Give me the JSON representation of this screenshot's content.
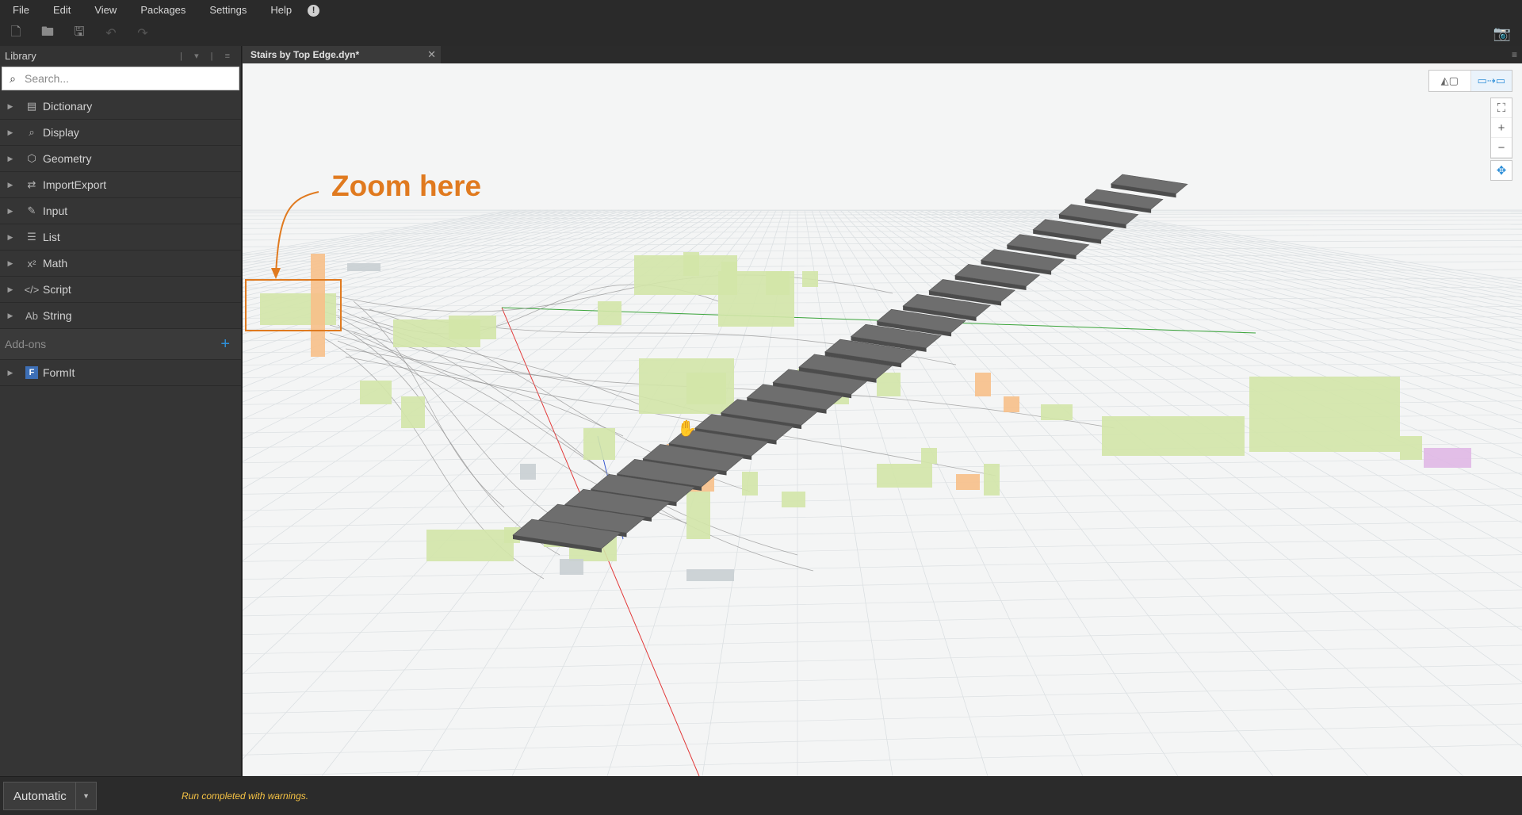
{
  "menu": {
    "items": [
      "File",
      "Edit",
      "View",
      "Packages",
      "Settings",
      "Help"
    ],
    "alert_glyph": "!"
  },
  "toolbar": {
    "new_icon": "new-file-icon",
    "open_icon": "open-folder-icon",
    "save_icon": "save-icon",
    "undo_icon": "undo-icon",
    "redo_icon": "redo-icon",
    "camera_icon": "camera-icon"
  },
  "library": {
    "title": "Library",
    "search_placeholder": "Search...",
    "categories": [
      {
        "label": "Dictionary",
        "icon": "dictionary-icon",
        "glyph": "▤"
      },
      {
        "label": "Display",
        "icon": "magnifier-icon",
        "glyph": "⌕"
      },
      {
        "label": "Geometry",
        "icon": "cube-icon",
        "glyph": "⬡"
      },
      {
        "label": "ImportExport",
        "icon": "arrows-icon",
        "glyph": "⇄"
      },
      {
        "label": "Input",
        "icon": "pencil-icon",
        "glyph": "✎"
      },
      {
        "label": "List",
        "icon": "list-icon",
        "glyph": "☰"
      },
      {
        "label": "Math",
        "icon": "math-icon",
        "glyph": "x²"
      },
      {
        "label": "Script",
        "icon": "code-icon",
        "glyph": "</>"
      },
      {
        "label": "String",
        "icon": "text-icon",
        "glyph": "Ab"
      }
    ],
    "addons_label": "Add-ons",
    "addons": [
      {
        "label": "FormIt",
        "icon": "formit-icon",
        "glyph": "F"
      }
    ]
  },
  "tab": {
    "title": "Stairs by Top Edge.dyn*"
  },
  "canvas": {
    "annotation": "Zoom here",
    "accent_orange": "#e07a1f",
    "step_count": 24,
    "group_green": "#d3e5a8",
    "group_orange": "#f7c08a",
    "group_purple": "#e0b8e6"
  },
  "status": {
    "run_mode": "Automatic",
    "message": "Run completed with warnings.",
    "message_color": "#f5c244"
  }
}
